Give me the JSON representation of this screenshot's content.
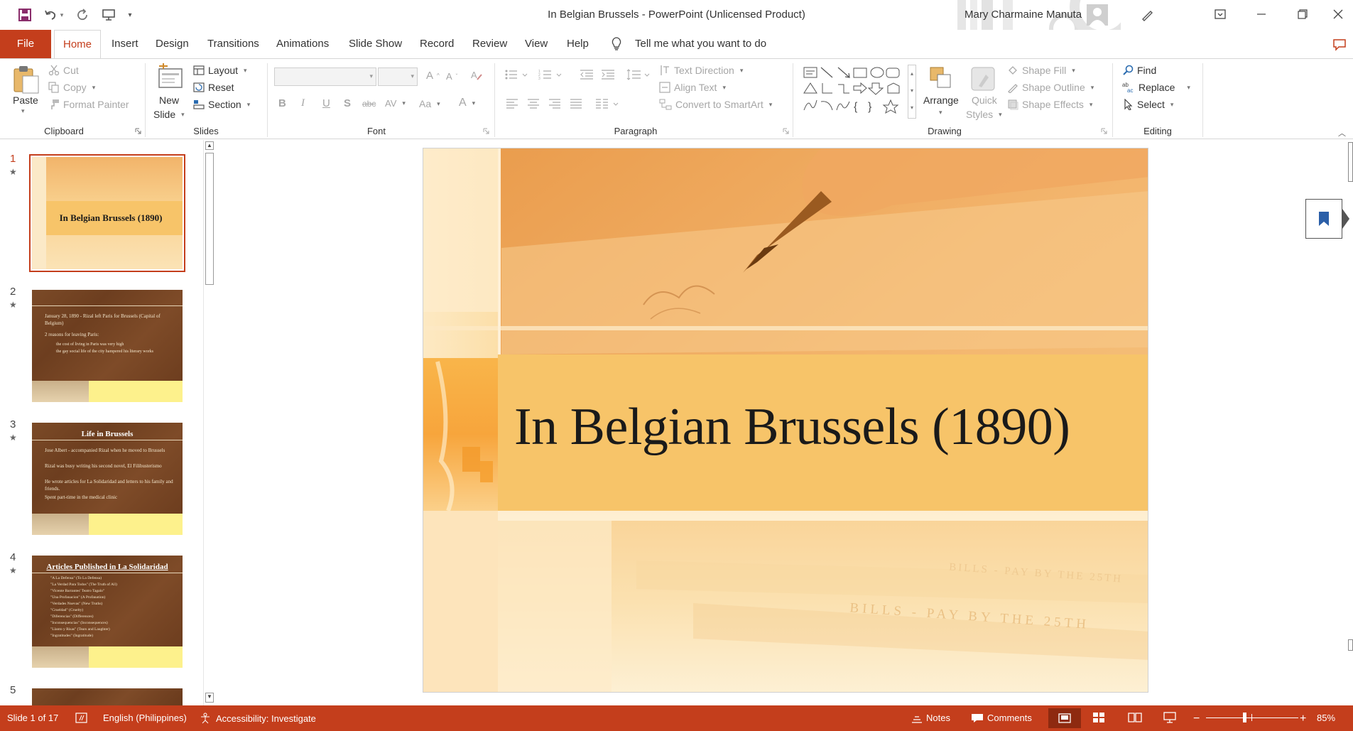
{
  "window": {
    "title": "In Belgian Brussels  -  PowerPoint (Unlicensed Product)",
    "user": "Mary Charmaine Manuta"
  },
  "tabs": [
    "File",
    "Home",
    "Insert",
    "Design",
    "Transitions",
    "Animations",
    "Slide Show",
    "Record",
    "Review",
    "View",
    "Help"
  ],
  "tell_me": "Tell me what you want to do",
  "ribbon": {
    "clipboard": {
      "paste": "Paste",
      "cut": "Cut",
      "copy": "Copy",
      "format_painter": "Format Painter",
      "label": "Clipboard"
    },
    "slides": {
      "new_slide_1": "New",
      "new_slide_2": "Slide",
      "layout": "Layout",
      "reset": "Reset",
      "section": "Section",
      "label": "Slides"
    },
    "font": {
      "label": "Font",
      "bold": "B",
      "italic": "I",
      "underline": "U",
      "shadow": "S",
      "strike": "abc",
      "spacing": "AV",
      "case": "Aa",
      "color": "A"
    },
    "paragraph": {
      "text_direction": "Text Direction",
      "align_text": "Align Text",
      "smartart": "Convert to SmartArt",
      "label": "Paragraph"
    },
    "drawing": {
      "arrange": "Arrange",
      "quick_styles_1": "Quick",
      "quick_styles_2": "Styles",
      "shape_fill": "Shape Fill",
      "shape_outline": "Shape Outline",
      "shape_effects": "Shape Effects",
      "label": "Drawing"
    },
    "editing": {
      "find": "Find",
      "replace": "Replace",
      "select": "Select",
      "label": "Editing"
    }
  },
  "thumbnails": [
    {
      "num": "1",
      "title": "In Belgian Brussels (1890)"
    },
    {
      "num": "2",
      "bullets": [
        "January 28, 1890 - Rizal left Paris for Brussels (Capital of Belgium)",
        "2 reasons for leaving Paris:"
      ],
      "subbullets": [
        "the cost of living in Paris was very high",
        "the gay social life of the city hampered his literary works"
      ]
    },
    {
      "num": "3",
      "title": "Life in Brussels",
      "bullets": [
        "Jose Albert - accompanied Rizal when he moved to Brussels",
        "Rizal was busy writing his second novel, El Filibusterismo",
        "He wrote articles for La Solidaridad and letters to his family and friends.",
        "Spent part-time in the medical clinic"
      ]
    },
    {
      "num": "4",
      "title": "Articles Published in La Solidaridad",
      "items": [
        "\"A La Defensa\" (To La Defensa)",
        "\"La Verdad Para Todos\" (The Truth of All)",
        "\"Vicente Barrantes' Teatro Tagalo\"",
        "\"Una Profanacion\" (A Profanation)",
        "\"Verdades Nuevas\" (New Truths)",
        "\"Crueldad\" (Cruelty)",
        "\"Diferencias\" (Differences)",
        "\"Inconsequencias\" (Inconsequences)",
        "\"Llanto y Risas\" (Tears and Laughter)",
        "\"Ingratitudes\" (Ingratitude)"
      ]
    },
    {
      "num": "5"
    }
  ],
  "slide": {
    "title": "In Belgian Brussels (1890)",
    "bills_text": "BILLS - PAY BY THE 25TH",
    "bills_text2": "BILLS  -  PAY BY THE  25TH"
  },
  "status": {
    "slide_info": "Slide 1 of 17",
    "language": "English (Philippines)",
    "accessibility": "Accessibility: Investigate",
    "notes": "Notes",
    "comments": "Comments",
    "zoom": "85%",
    "zoom_level": 0.85
  },
  "colors": {
    "accent": "#c43e1c",
    "slide_band": "#f7c469"
  }
}
